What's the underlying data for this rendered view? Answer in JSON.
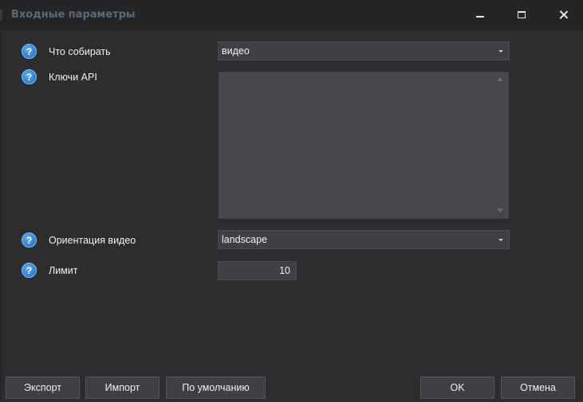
{
  "window": {
    "title": "Входные параметры"
  },
  "params": [
    {
      "label": "Что собирать",
      "type": "combo",
      "value": "видео"
    },
    {
      "label": "Ключи API",
      "type": "textarea",
      "value": ""
    },
    {
      "label": "Ориентация видео",
      "type": "combo",
      "value": "landscape"
    },
    {
      "label": "Лимит",
      "type": "number",
      "value": "10"
    }
  ],
  "help_glyph": "?",
  "buttons": {
    "export": "Экспорт",
    "import": "Импорт",
    "default": "По умолчанию",
    "ok": "OK",
    "cancel": "Отмена"
  },
  "colors": {
    "background": "#2d2d30",
    "titlebar": "#252528",
    "field": "#3f3f46",
    "help_icon": "#2f86dd"
  }
}
